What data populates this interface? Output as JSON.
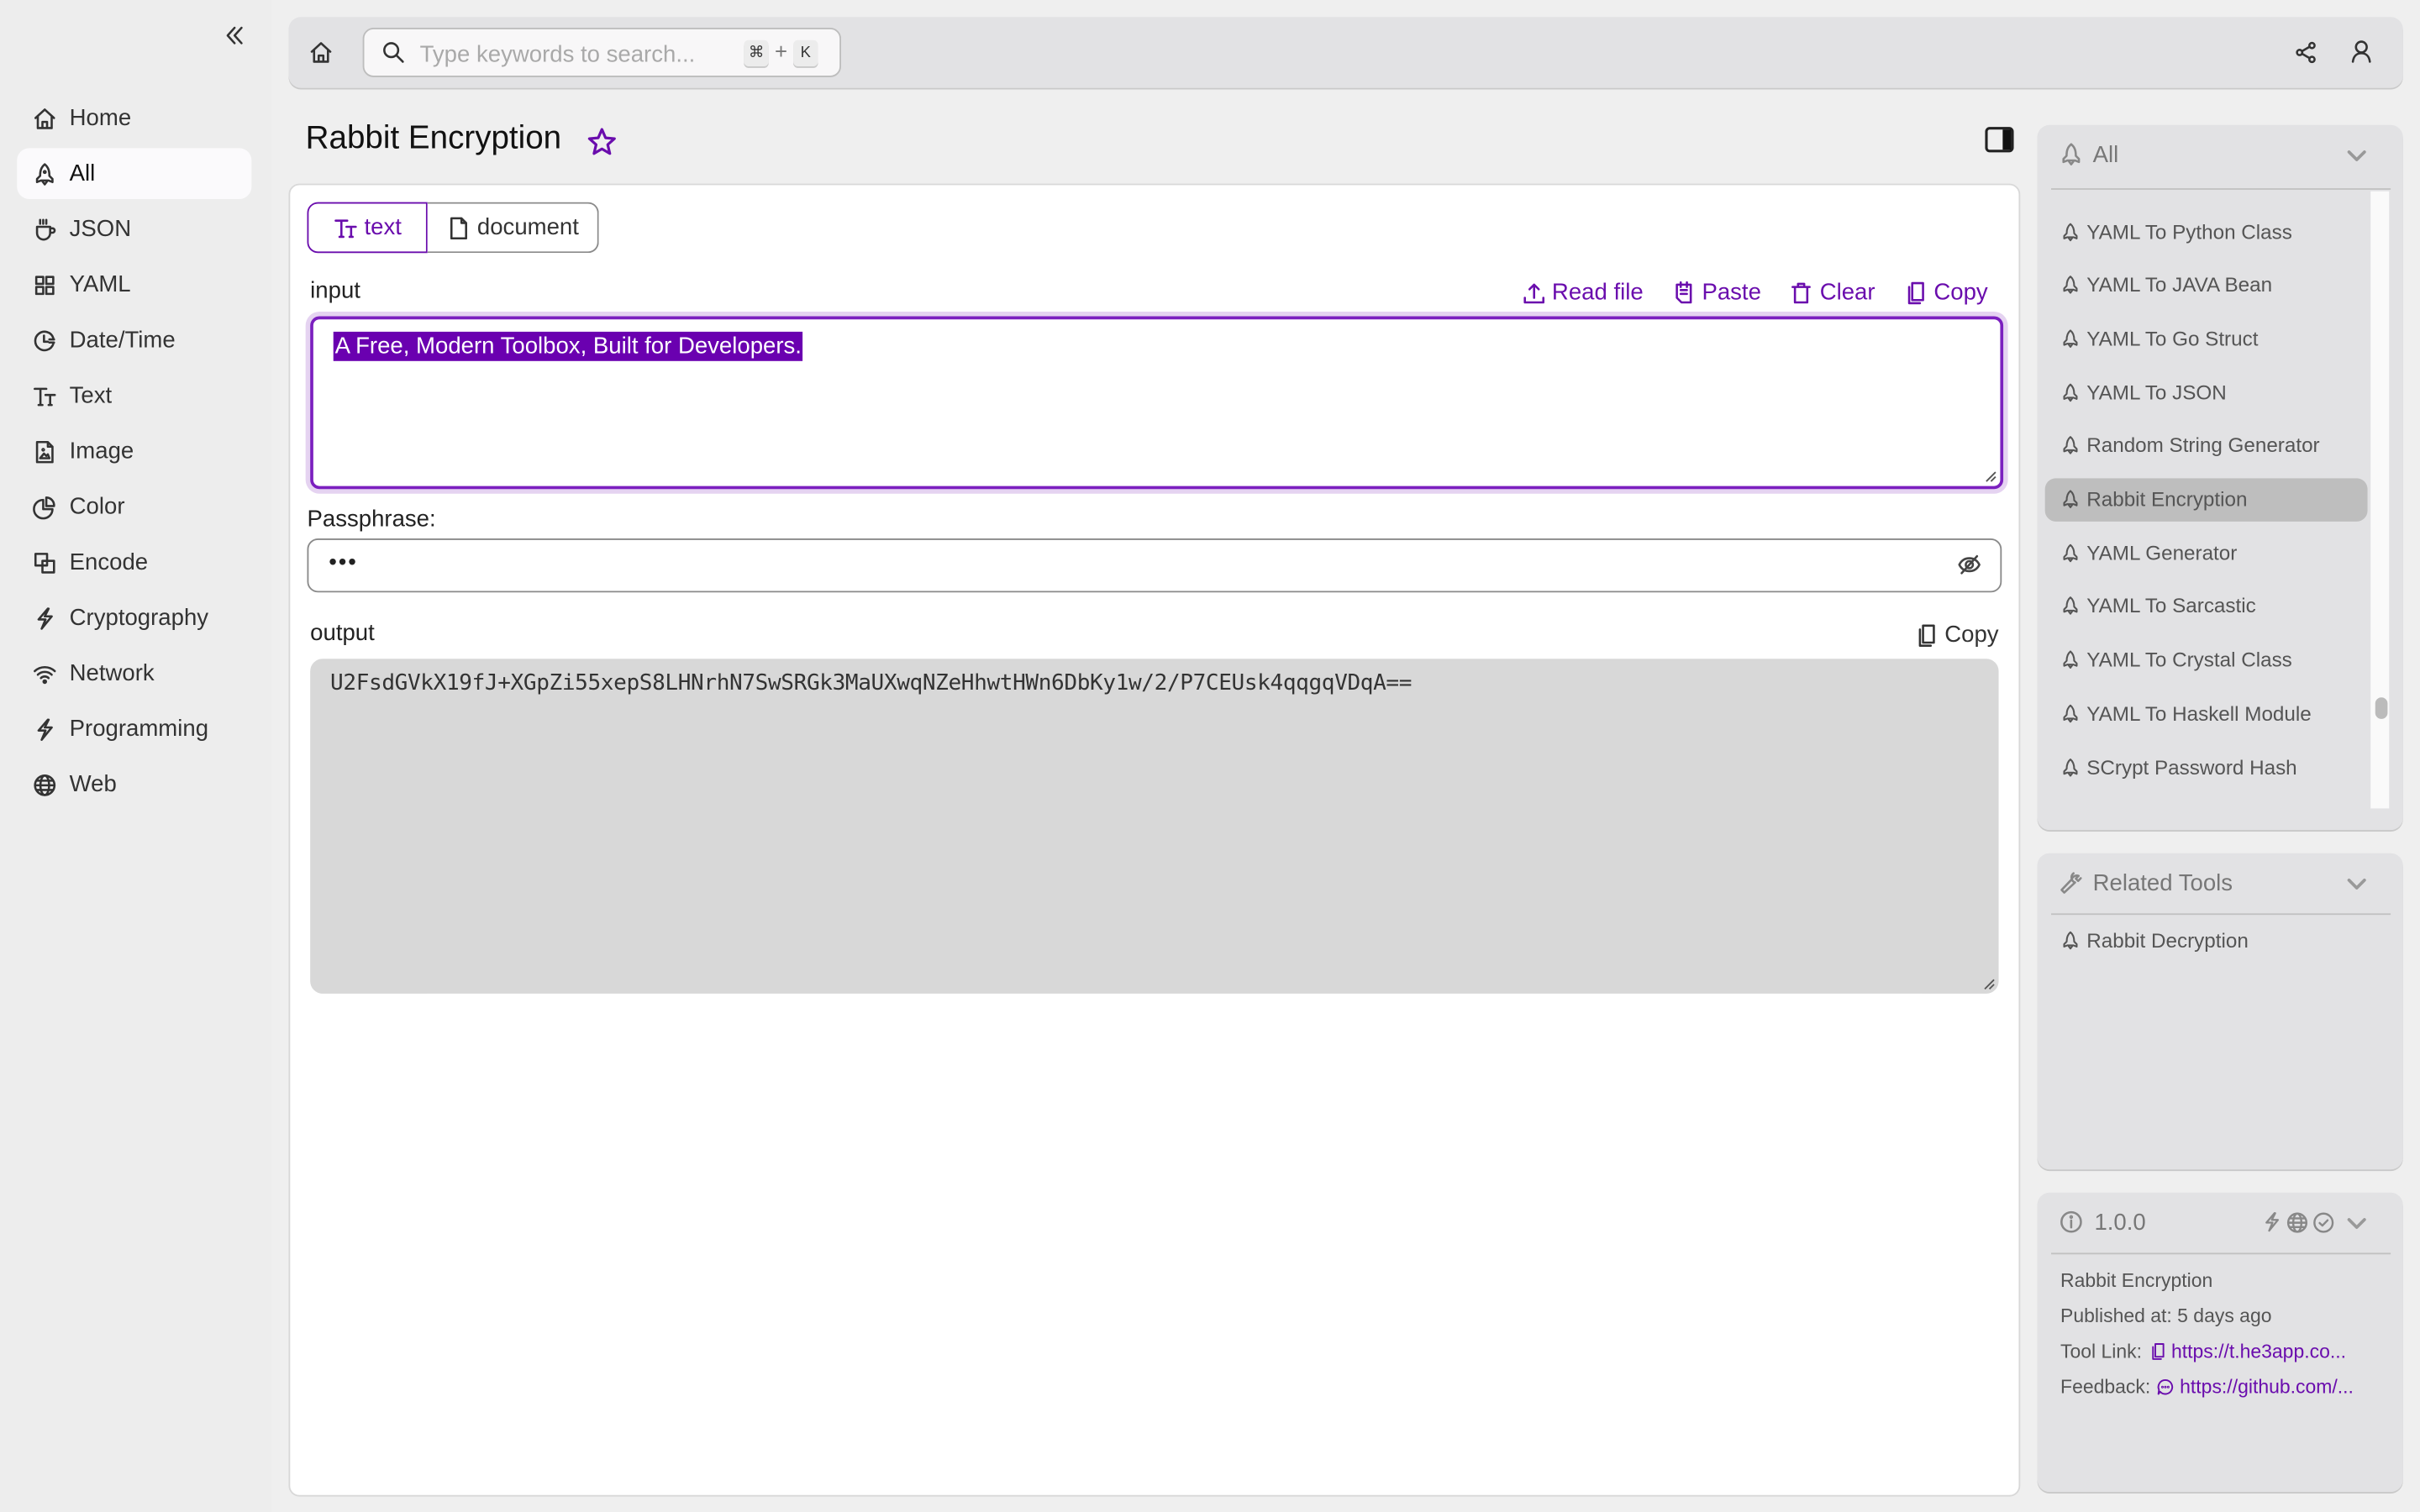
{
  "sidebar": {
    "items": [
      {
        "label": "Home",
        "icon": "home-icon"
      },
      {
        "label": "All",
        "icon": "rocket-icon",
        "active": true
      },
      {
        "label": "JSON",
        "icon": "coffee-cup-icon"
      },
      {
        "label": "YAML",
        "icon": "grid-icon"
      },
      {
        "label": "Date/Time",
        "icon": "clock-icon"
      },
      {
        "label": "Text",
        "icon": "text-size-icon"
      },
      {
        "label": "Image",
        "icon": "image-file-icon"
      },
      {
        "label": "Color",
        "icon": "pie-chart-icon"
      },
      {
        "label": "Encode",
        "icon": "overlap-squares-icon"
      },
      {
        "label": "Cryptography",
        "icon": "lightning-icon"
      },
      {
        "label": "Network",
        "icon": "wifi-icon"
      },
      {
        "label": "Programming",
        "icon": "lightning-icon"
      },
      {
        "label": "Web",
        "icon": "globe-icon"
      }
    ]
  },
  "topbar": {
    "search_placeholder": "Type keywords to search...",
    "shortcut_key1": "⌘",
    "shortcut_plus": "+",
    "shortcut_key2": "K"
  },
  "page": {
    "title": "Rabbit Encryption"
  },
  "tabs": [
    {
      "label": "text",
      "active": true
    },
    {
      "label": "document",
      "active": false
    }
  ],
  "input": {
    "label": "input",
    "value": "A Free, Modern Toolbox, Built for Developers.",
    "actions": {
      "read_file": "Read file",
      "paste": "Paste",
      "clear": "Clear",
      "copy": "Copy"
    }
  },
  "passphrase": {
    "label": "Passphrase:",
    "masked_value": "•••"
  },
  "output": {
    "label": "output",
    "copy": "Copy",
    "value": "U2FsdGVkX19fJ+XGpZi55xepS8LHNrhN7SwSRGk3MaUXwqNZeHhwtHWn6DbKy1w/2/P7CEUsk4qqgqVDqA=="
  },
  "tool_list": {
    "header": "All",
    "items": [
      {
        "label": "YAML To Python Class"
      },
      {
        "label": "YAML To JAVA Bean"
      },
      {
        "label": "YAML To Go Struct"
      },
      {
        "label": "YAML To JSON"
      },
      {
        "label": "Random String Generator"
      },
      {
        "label": "Rabbit Encryption",
        "active": true
      },
      {
        "label": "YAML Generator"
      },
      {
        "label": "YAML To Sarcastic"
      },
      {
        "label": "YAML To Crystal Class"
      },
      {
        "label": "YAML To Haskell Module"
      },
      {
        "label": "SCrypt Password Hash"
      }
    ]
  },
  "related": {
    "header": "Related Tools",
    "items": [
      {
        "label": "Rabbit Decryption"
      }
    ]
  },
  "info": {
    "version": "1.0.0",
    "name": "Rabbit Encryption",
    "published": "Published at: 5 days ago",
    "tool_link_label": "Tool Link:",
    "tool_link": "https://t.he3app.co...",
    "feedback_label": "Feedback:",
    "feedback_link": "https://github.com/..."
  },
  "colors": {
    "accent": "#6a0dad",
    "selection_bg": "#6a00b0",
    "output_bg": "#d8d8d8",
    "panel_bg": "#e2e2e4"
  }
}
